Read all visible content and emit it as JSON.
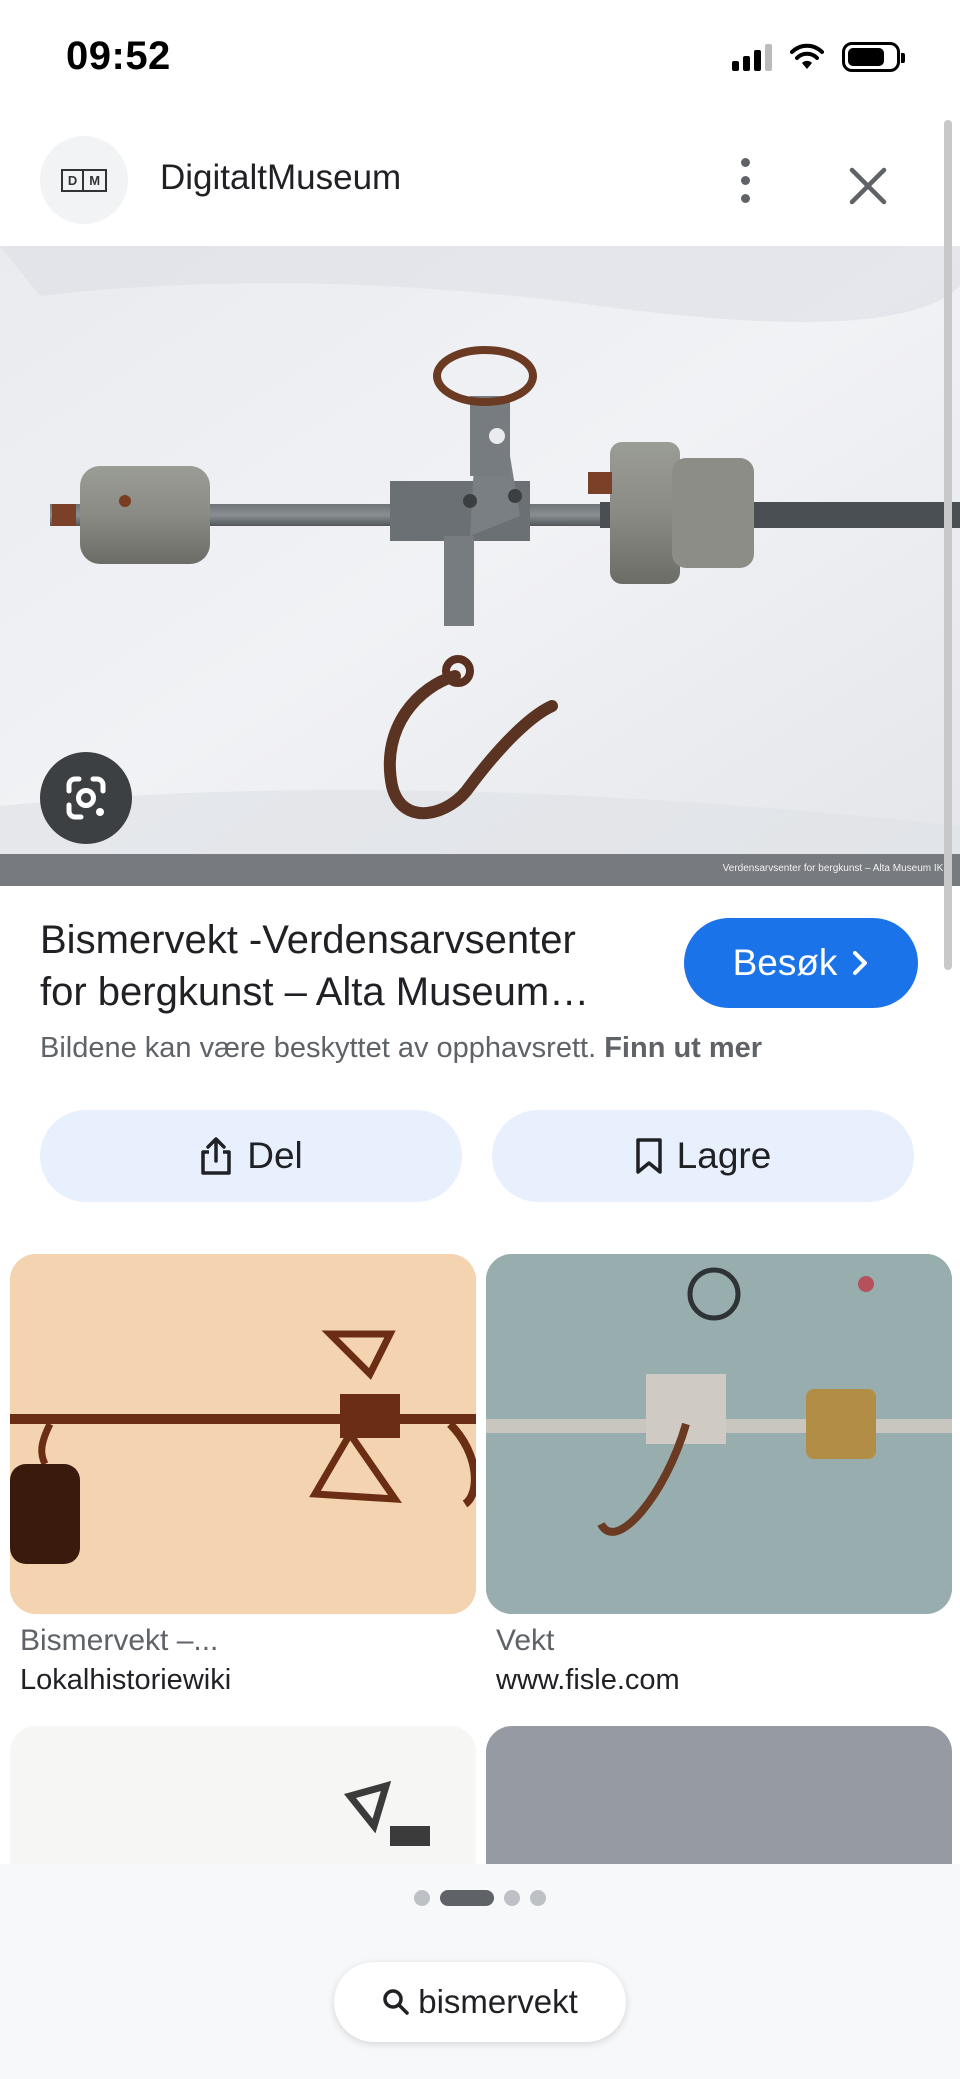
{
  "status_bar": {
    "time": "09:52"
  },
  "header": {
    "site_name": "DigitaltMuseum",
    "logo_letters": [
      "D",
      "M"
    ]
  },
  "image": {
    "caption": "Verdensarvsenter for bergkunst – Alta Museum IKS"
  },
  "result": {
    "title_line1": "Bismervekt -Verdensarvsenter",
    "title_line2": "for bergkunst – Alta Museum…",
    "visit_label": "Besøk",
    "copyright_text": "Bildene kan være beskyttet av opphavsrett.",
    "learn_more": "Finn ut mer"
  },
  "actions": {
    "share_label": "Del",
    "save_label": "Lagre"
  },
  "related": [
    {
      "title": "Bismervekt –...",
      "source": "Lokalhistoriewiki"
    },
    {
      "title": "Vekt",
      "source": "www.fisle.com"
    }
  ],
  "search": {
    "query": "bismervekt"
  },
  "colors": {
    "accent": "#1a73e8",
    "chip_bg": "#e8f0fe"
  },
  "icons": [
    "google-lens-icon",
    "share-icon",
    "bookmark-icon",
    "chevron-right-icon",
    "search-icon",
    "close-icon",
    "more-vert-icon"
  ]
}
